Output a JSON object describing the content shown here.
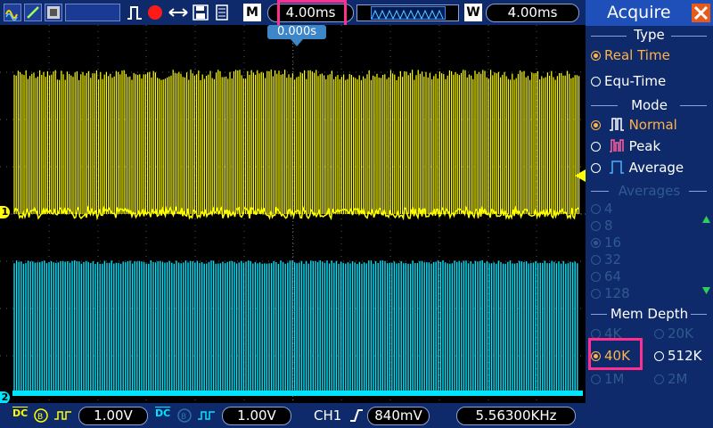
{
  "top_bar": {
    "timebase": "4.00ms",
    "trigger_offset": "0.000s",
    "window_timebase": "4.00ms",
    "m_label": "M",
    "w_label": "W"
  },
  "menu": {
    "title": "Acquire",
    "type": {
      "heading": "Type",
      "options": [
        "Real Time",
        "Equ-Time"
      ],
      "selected": "Real Time"
    },
    "mode": {
      "heading": "Mode",
      "options": [
        "Normal",
        "Peak",
        "Average"
      ],
      "selected": "Normal"
    },
    "averages": {
      "heading": "Averages",
      "options": [
        "4",
        "8",
        "16",
        "32",
        "64",
        "128"
      ],
      "selected": "16"
    },
    "mem_depth": {
      "heading": "Mem Depth",
      "options": [
        "4K",
        "20K",
        "40K",
        "512K",
        "1M",
        "2M"
      ],
      "selected": "40K"
    }
  },
  "bottom_bar": {
    "ch1_coupling": "DC",
    "ch1_scale": "1.00V",
    "ch2_coupling": "DC",
    "ch2_scale": "1.00V",
    "trigger_source": "CH1",
    "trigger_level": "840mV",
    "frequency": "5.56300KHz"
  },
  "channels": {
    "ch1_marker": "1",
    "ch2_marker": "2",
    "ch1_color": "#ffff00",
    "ch2_color": "#00e5ff"
  },
  "colors": {
    "highlight": "#ff2f8f",
    "menu_bg": "#0e2a6b",
    "selected_option": "#ffb347",
    "disabled_option": "#2f5a8c"
  }
}
